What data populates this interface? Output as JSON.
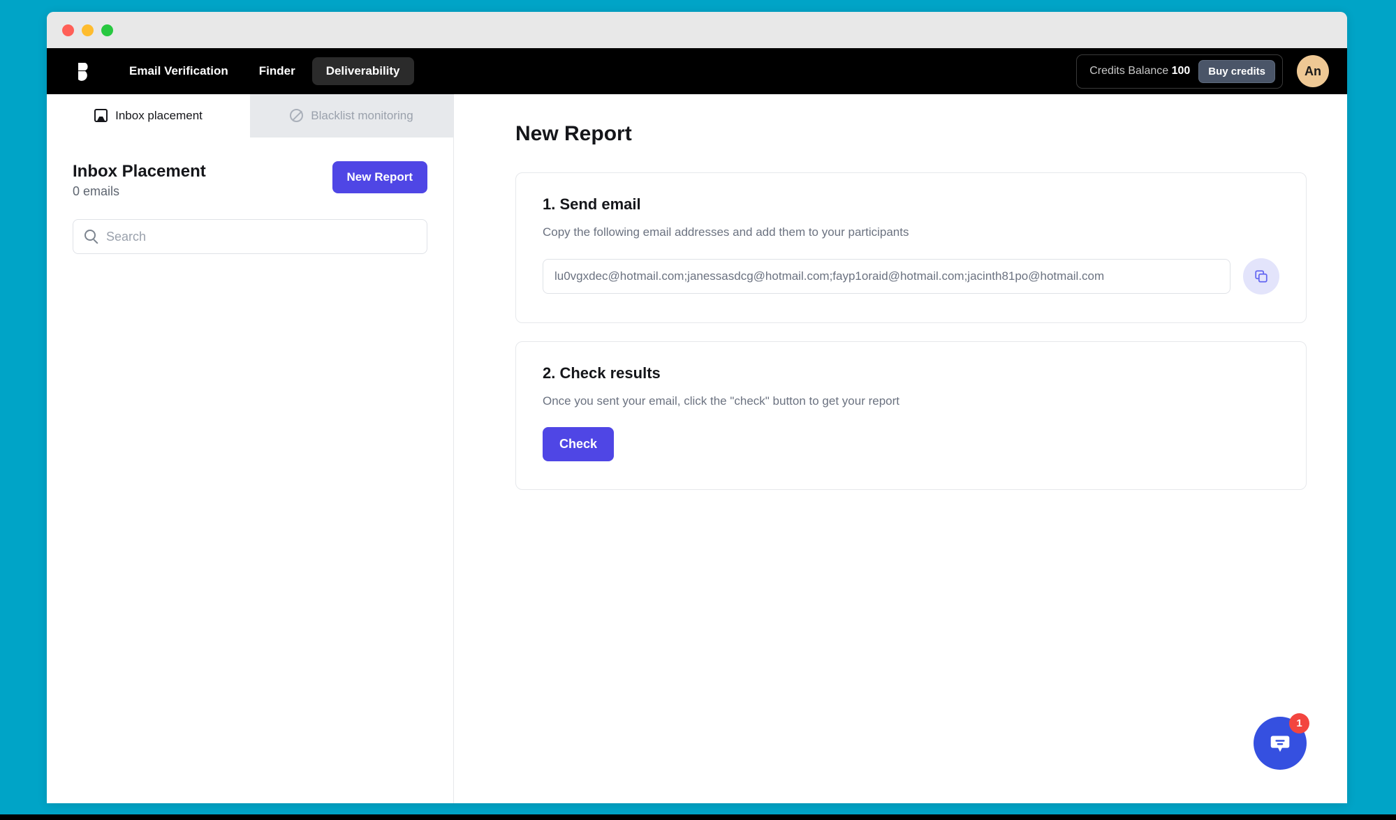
{
  "window": {
    "traffic_lights": [
      "close",
      "minimize",
      "maximize"
    ]
  },
  "header": {
    "logo_name": "bouncer-logo",
    "nav": [
      {
        "label": "Email Verification",
        "active": false
      },
      {
        "label": "Finder",
        "active": false
      },
      {
        "label": "Deliverability",
        "active": true
      }
    ],
    "credits": {
      "label": "Credits Balance",
      "value": "100",
      "buy_label": "Buy credits"
    },
    "avatar_initials": "An"
  },
  "sidebar": {
    "tabs": [
      {
        "label": "Inbox placement",
        "icon": "inbox-icon",
        "active": true
      },
      {
        "label": "Blacklist monitoring",
        "icon": "ban-icon",
        "active": false
      }
    ],
    "title": "Inbox Placement",
    "subtitle": "0 emails",
    "new_report_label": "New Report",
    "search_placeholder": "Search"
  },
  "main": {
    "page_title": "New Report",
    "step1": {
      "title": "1. Send email",
      "description": "Copy the following email addresses and add them to your participants",
      "emails_value": "lu0vgxdec@hotmail.com;janessasdcg@hotmail.com;fayp1oraid@hotmail.com;jacinth81po@hotmail.com",
      "copy_icon": "copy-icon"
    },
    "step2": {
      "title": "2. Check results",
      "description": "Once you sent your email, click the \"check\" button to get your report",
      "check_label": "Check"
    }
  },
  "chat": {
    "icon": "chat-bubble-icon",
    "badge_count": "1"
  },
  "colors": {
    "desktop_bg": "#00a4c7",
    "header_bg": "#000000",
    "accent_purple": "#4f46e5",
    "chat_blue": "#3550e0",
    "badge_red": "#f3453f",
    "avatar_tan": "#eec894"
  }
}
